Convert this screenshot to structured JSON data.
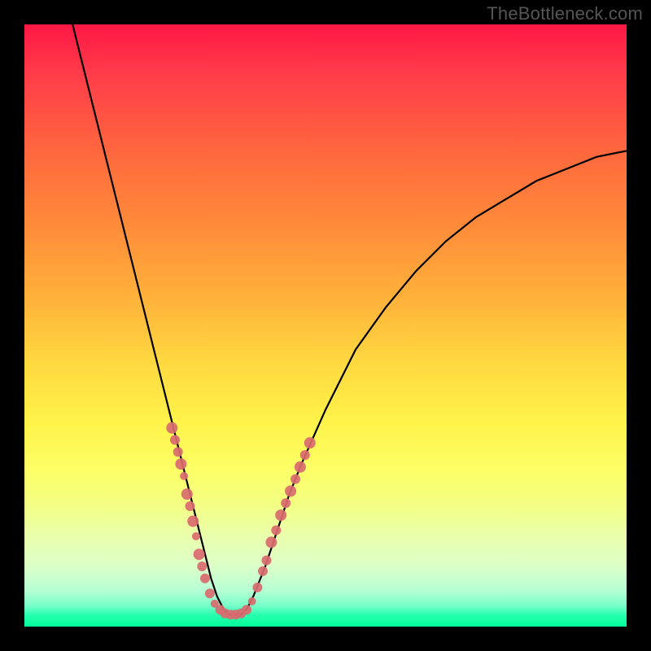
{
  "watermark": "TheBottleneck.com",
  "colors": {
    "top": "#ff1744",
    "mid": "#ffe24a",
    "bottom": "#00ff99",
    "curve": "#000000",
    "markers": "#d96a6f"
  },
  "chart_data": {
    "type": "line",
    "title": "",
    "xlabel": "",
    "ylabel": "",
    "xlim": [
      0,
      100
    ],
    "ylim": [
      0,
      100
    ],
    "grid": false,
    "series": [
      {
        "name": "bottleneck-curve",
        "x": [
          8,
          10,
          12,
          14,
          16,
          18,
          20,
          22,
          24,
          26,
          27,
          28,
          29,
          30,
          31,
          32,
          33,
          34,
          35,
          36,
          37,
          38,
          40,
          42,
          44,
          46,
          50,
          55,
          60,
          65,
          70,
          75,
          80,
          85,
          90,
          95,
          100
        ],
        "y": [
          100,
          92,
          84,
          76,
          68,
          60,
          52,
          44,
          36,
          28,
          24,
          20,
          16,
          12,
          8,
          5,
          3,
          2,
          2,
          2,
          3,
          5,
          10,
          16,
          22,
          27,
          36,
          46,
          53,
          59,
          64,
          68,
          71,
          74,
          76,
          78,
          79
        ]
      }
    ],
    "markers": [
      {
        "x": 24.5,
        "y": 33,
        "r": 7
      },
      {
        "x": 25.0,
        "y": 31,
        "r": 6
      },
      {
        "x": 25.5,
        "y": 29,
        "r": 6
      },
      {
        "x": 26.0,
        "y": 27,
        "r": 7
      },
      {
        "x": 26.5,
        "y": 25,
        "r": 5
      },
      {
        "x": 27.0,
        "y": 22,
        "r": 7
      },
      {
        "x": 27.5,
        "y": 20,
        "r": 6
      },
      {
        "x": 28.0,
        "y": 17.5,
        "r": 7
      },
      {
        "x": 28.5,
        "y": 15,
        "r": 5
      },
      {
        "x": 29.0,
        "y": 12,
        "r": 7
      },
      {
        "x": 29.5,
        "y": 10,
        "r": 6
      },
      {
        "x": 30.0,
        "y": 8,
        "r": 6
      },
      {
        "x": 30.8,
        "y": 5.5,
        "r": 6
      },
      {
        "x": 31.6,
        "y": 3.8,
        "r": 5
      },
      {
        "x": 32.5,
        "y": 2.8,
        "r": 6
      },
      {
        "x": 33.3,
        "y": 2.2,
        "r": 6
      },
      {
        "x": 34.2,
        "y": 2.0,
        "r": 6
      },
      {
        "x": 35.1,
        "y": 2.0,
        "r": 6
      },
      {
        "x": 36.0,
        "y": 2.2,
        "r": 6
      },
      {
        "x": 36.9,
        "y": 2.8,
        "r": 6
      },
      {
        "x": 37.8,
        "y": 4.2,
        "r": 5
      },
      {
        "x": 38.7,
        "y": 6.5,
        "r": 6
      },
      {
        "x": 39.6,
        "y": 9.2,
        "r": 6
      },
      {
        "x": 40.2,
        "y": 11,
        "r": 6
      },
      {
        "x": 41.0,
        "y": 14,
        "r": 7
      },
      {
        "x": 41.8,
        "y": 16,
        "r": 6
      },
      {
        "x": 42.6,
        "y": 18.5,
        "r": 7
      },
      {
        "x": 43.4,
        "y": 20.5,
        "r": 6
      },
      {
        "x": 44.2,
        "y": 22.5,
        "r": 7
      },
      {
        "x": 45.0,
        "y": 24.5,
        "r": 6
      },
      {
        "x": 45.8,
        "y": 26.5,
        "r": 7
      },
      {
        "x": 46.6,
        "y": 28.5,
        "r": 6
      },
      {
        "x": 47.4,
        "y": 30.5,
        "r": 7
      }
    ]
  }
}
